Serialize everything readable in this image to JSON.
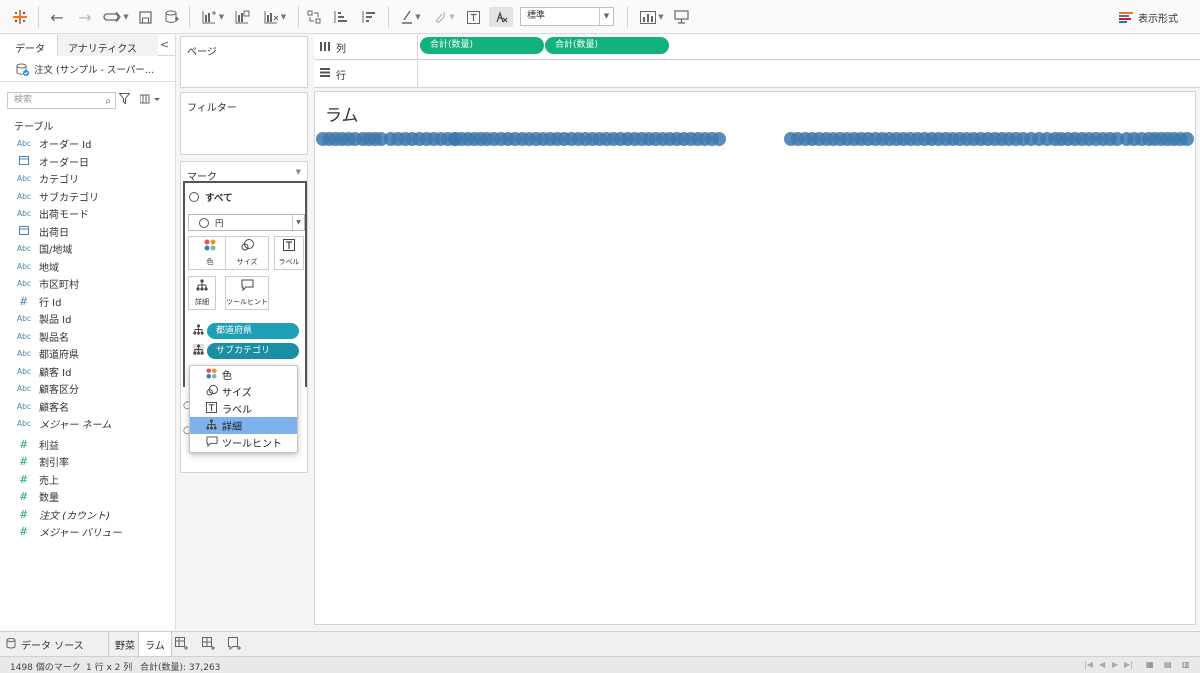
{
  "toolbar": {
    "fit_value": "標準",
    "show_me_label": "表示形式",
    "brand_colors": [
      "#e8762b",
      "#5b6f9e",
      "#c72035",
      "#1f77b4"
    ]
  },
  "data_pane": {
    "tab_data": "データ",
    "tab_analytics": "アナリティクス",
    "collapse": "<",
    "source": "注文 (サンプル - スーパー...",
    "search_placeholder": "検索",
    "section": "テーブル",
    "dimensions": [
      {
        "type": "abc",
        "name": "オーダー Id"
      },
      {
        "type": "cal",
        "name": "オーダー日"
      },
      {
        "type": "abc",
        "name": "カテゴリ"
      },
      {
        "type": "abc",
        "name": "サブカテゴリ"
      },
      {
        "type": "abc",
        "name": "出荷モード"
      },
      {
        "type": "cal",
        "name": "出荷日"
      },
      {
        "type": "abc",
        "name": "国/地域"
      },
      {
        "type": "abc",
        "name": "地域"
      },
      {
        "type": "abc",
        "name": "市区町村"
      },
      {
        "type": "num",
        "name": "行 Id"
      },
      {
        "type": "abc",
        "name": "製品 Id"
      },
      {
        "type": "abc",
        "name": "製品名"
      },
      {
        "type": "abc",
        "name": "都道府県"
      },
      {
        "type": "abc",
        "name": "顧客 Id"
      },
      {
        "type": "abc",
        "name": "顧客区分"
      },
      {
        "type": "abc",
        "name": "顧客名"
      },
      {
        "type": "abc",
        "name": "メジャー ネーム",
        "italic": true
      }
    ],
    "measures": [
      {
        "name": "利益"
      },
      {
        "name": "割引率"
      },
      {
        "name": "売上"
      },
      {
        "name": "数量"
      },
      {
        "name": "注文 (カウント)",
        "italic": true
      },
      {
        "name": "メジャー バリュー",
        "italic": true
      }
    ]
  },
  "cards": {
    "pages": "ページ",
    "filters": "フィルター",
    "marks": "マーク",
    "all": "すべて",
    "mark_type": "円",
    "btn_color": "色",
    "btn_size": "サイズ",
    "btn_label": "ラベル",
    "btn_detail": "詳細",
    "btn_tooltip": "ツールヒント",
    "pill1": "都道府県",
    "pill2": "サブカテゴリ"
  },
  "popup": {
    "items": [
      "色",
      "サイズ",
      "ラベル",
      "詳細",
      "ツールヒント"
    ],
    "selected": "詳細",
    "selected_color": "#7fb1ef"
  },
  "shelves": {
    "columns_label": "列",
    "rows_label": "行",
    "col_pill1": "合計(数量)",
    "col_pill2": "合計(数量)",
    "pill_color": "#12b27a"
  },
  "viz": {
    "title": "ラム",
    "mark_color": "#3d78ad"
  },
  "tabs": {
    "datasource": "データ ソース",
    "sheet1": "野菜",
    "sheet2": "ラム"
  },
  "status": {
    "marks": "1498 個のマーク",
    "dims": "1 行 x 2 列",
    "sum": "合計(数量): 37,263"
  }
}
